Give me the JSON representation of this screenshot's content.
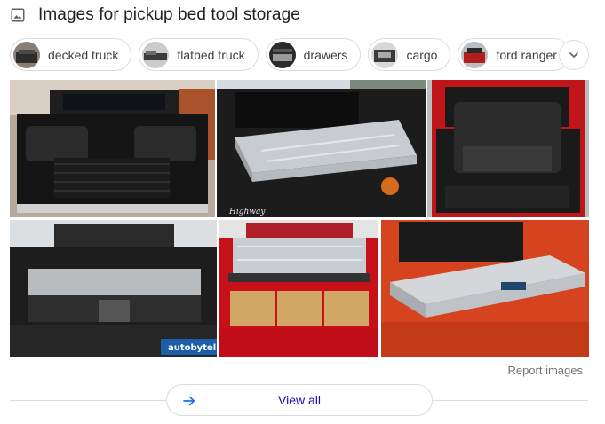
{
  "header": {
    "title": "Images for pickup bed tool storage",
    "icon": "image-icon"
  },
  "chips": [
    {
      "label": "decked truck",
      "icon": "decked-truck-thumb"
    },
    {
      "label": "flatbed truck",
      "icon": "flatbed-truck-thumb"
    },
    {
      "label": "drawers",
      "icon": "drawers-thumb"
    },
    {
      "label": "cargo",
      "icon": "cargo-thumb"
    },
    {
      "label": "ford ranger",
      "icon": "ford-ranger-thumb"
    }
  ],
  "more_button": {
    "icon": "chevron-down-icon"
  },
  "images": [
    {
      "watermark": ""
    },
    {
      "watermark": "Highway"
    },
    {
      "watermark": ""
    },
    {
      "watermark": "autobytel"
    },
    {
      "watermark": ""
    },
    {
      "watermark": ""
    }
  ],
  "footer": {
    "report_label": "Report images",
    "view_all_label": "View all",
    "view_all_icon": "arrow-right-icon"
  },
  "colors": {
    "link": "#1a0dab",
    "arrow": "#1a73e8",
    "border": "#dadce0"
  }
}
